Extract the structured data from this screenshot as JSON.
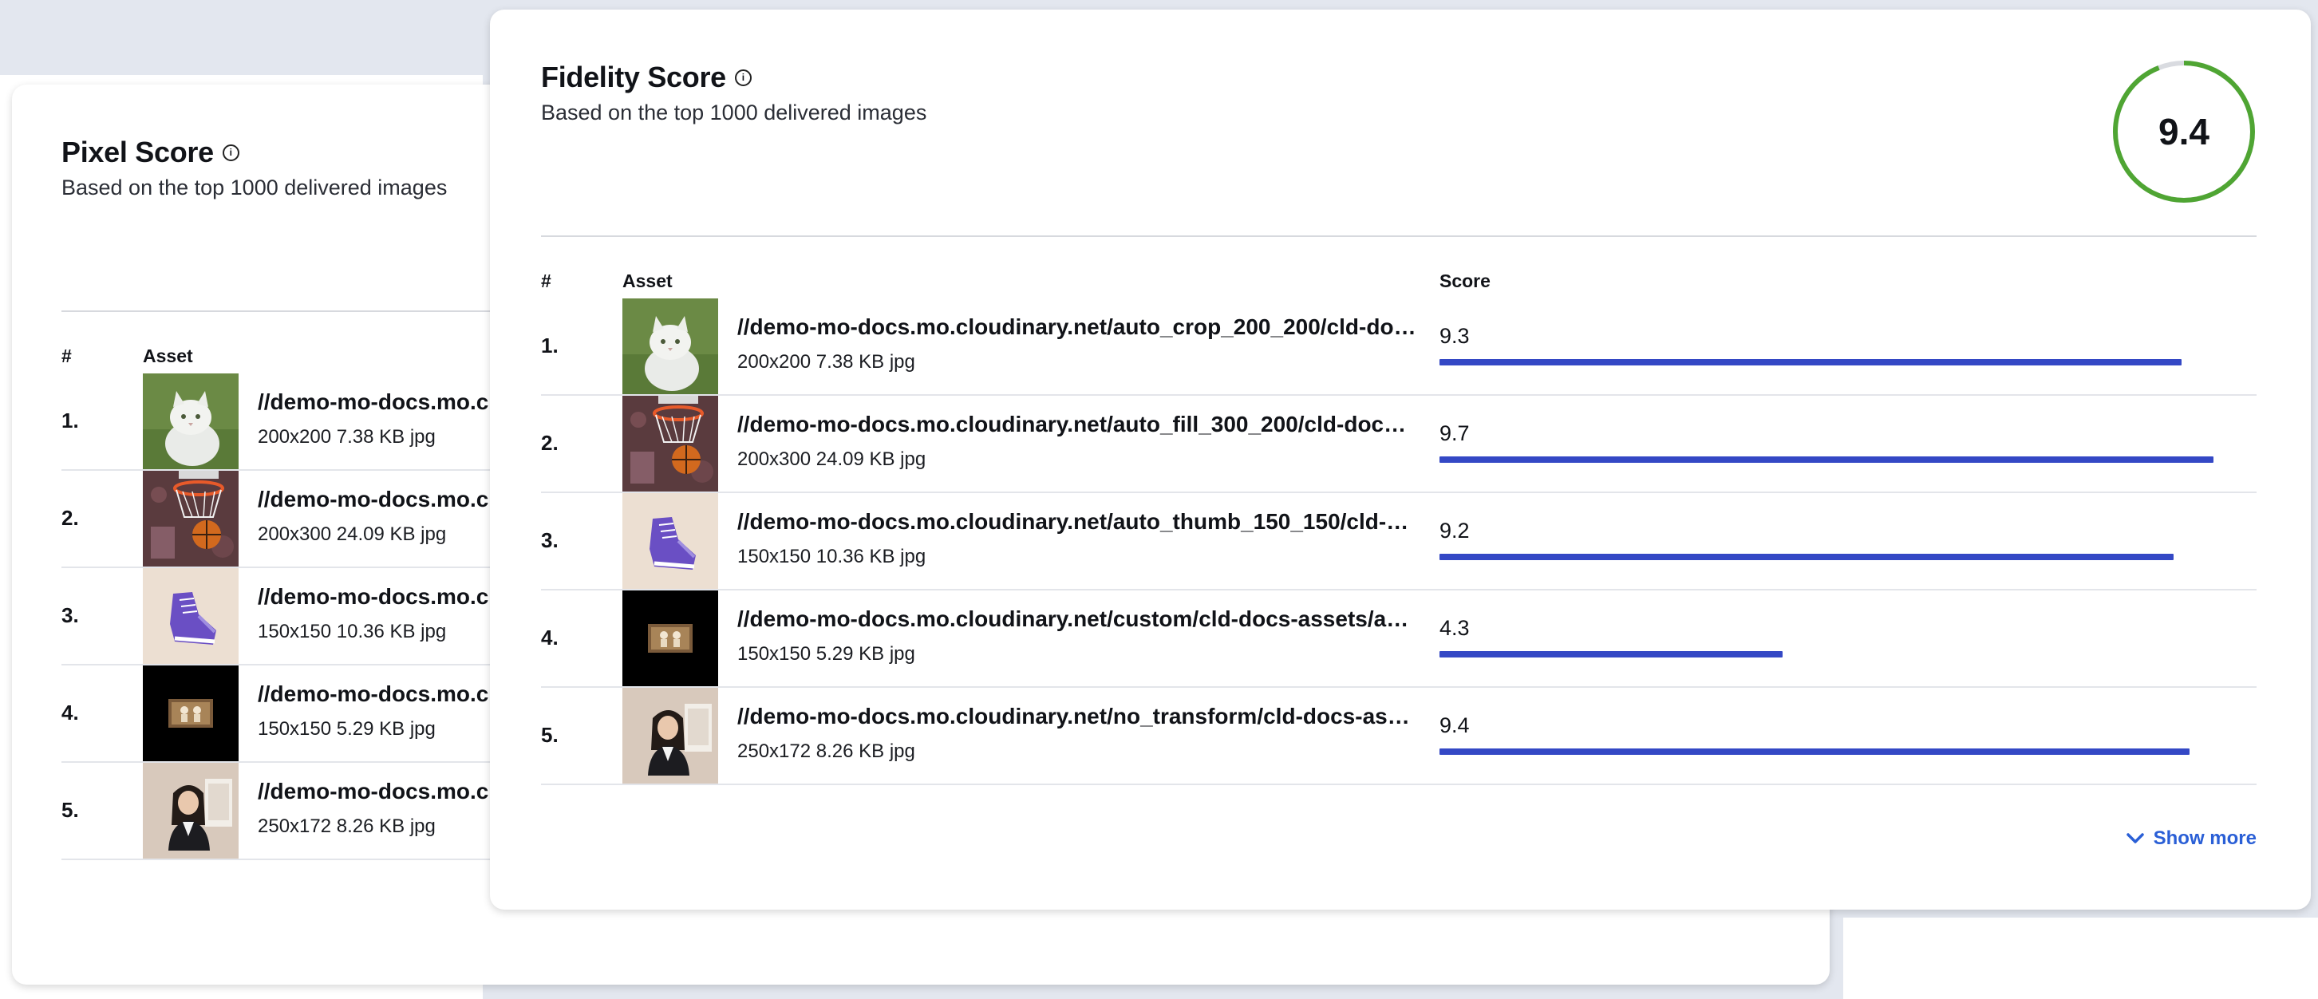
{
  "pixel_card": {
    "title": "Pixel Score",
    "subtitle": "Based on the top 1000 delivered images",
    "columns": {
      "num": "#",
      "asset": "Asset"
    },
    "rows": [
      {
        "num": "1.",
        "url": "//demo-mo-docs.mo.c",
        "meta": "200x200 7.38 KB jpg",
        "thumb": "cat"
      },
      {
        "num": "2.",
        "url": "//demo-mo-docs.mo.c",
        "meta": "200x300 24.09 KB jpg",
        "thumb": "basketball"
      },
      {
        "num": "3.",
        "url": "//demo-mo-docs.mo.c",
        "meta": "150x150 10.36 KB jpg",
        "thumb": "sneaker"
      },
      {
        "num": "4.",
        "url": "//demo-mo-docs.mo.c",
        "meta": "150x150 5.29 KB jpg",
        "thumb": "dark-photo"
      },
      {
        "num": "5.",
        "url": "//demo-mo-docs.mo.c",
        "meta": "250x172 8.26 KB jpg",
        "thumb": "woman"
      }
    ]
  },
  "fidelity_card": {
    "title": "Fidelity Score",
    "subtitle": "Based on the top 1000 delivered images",
    "overall_score": "9.4",
    "overall_score_value": 9.4,
    "columns": {
      "num": "#",
      "asset": "Asset",
      "score": "Score"
    },
    "rows": [
      {
        "num": "1.",
        "url": "//demo-mo-docs.mo.cloudinary.net/auto_crop_200_200/cld-doc...",
        "meta": "200x200 7.38 KB jpg",
        "score": "9.3",
        "score_value": 9.3,
        "thumb": "cat"
      },
      {
        "num": "2.",
        "url": "//demo-mo-docs.mo.cloudinary.net/auto_fill_300_200/cld-docs-...",
        "meta": "200x300 24.09 KB jpg",
        "score": "9.7",
        "score_value": 9.7,
        "thumb": "basketball"
      },
      {
        "num": "3.",
        "url": "//demo-mo-docs.mo.cloudinary.net/auto_thumb_150_150/cld-do...",
        "meta": "150x150 10.36 KB jpg",
        "score": "9.2",
        "score_value": 9.2,
        "thumb": "sneaker"
      },
      {
        "num": "4.",
        "url": "//demo-mo-docs.mo.cloudinary.net/custom/cld-docs-assets/ass...",
        "meta": "150x150 5.29 KB jpg",
        "score": "4.3",
        "score_value": 4.3,
        "thumb": "dark-photo"
      },
      {
        "num": "5.",
        "url": "//demo-mo-docs.mo.cloudinary.net/no_transform/cld-docs-asse...",
        "meta": "250x172 8.26 KB jpg",
        "score": "9.4",
        "score_value": 9.4,
        "thumb": "woman"
      }
    ],
    "show_more_label": "Show more"
  },
  "colors": {
    "bar": "#3448c5",
    "gauge_ring": "#4fa533",
    "gauge_track": "#d9dbe0",
    "link": "#2a5fd6"
  }
}
